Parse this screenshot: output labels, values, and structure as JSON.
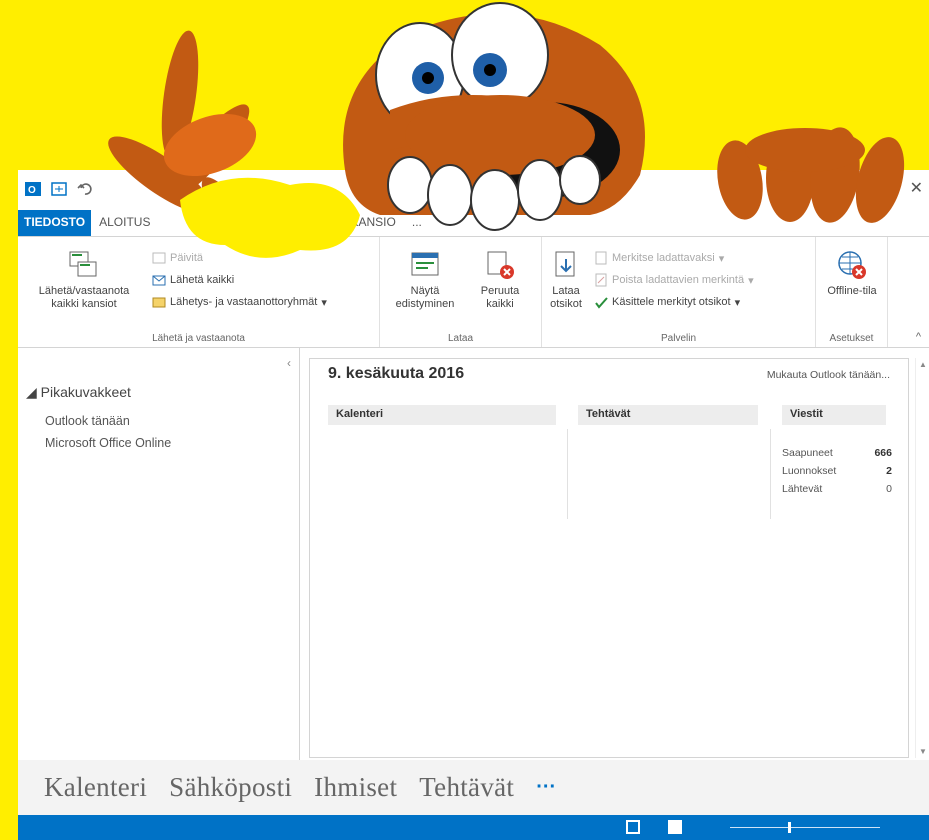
{
  "colors": {
    "background": "#ffee00",
    "accent": "#0072c6",
    "monster": "#c25a13",
    "monster_light": "#e06a1a"
  },
  "window": {
    "close_glyph": "✕"
  },
  "tabs": [
    {
      "label": "TIEDOSTO"
    },
    {
      "label": "ALOITUS"
    },
    {
      "label": "A"
    },
    {
      "label": "KANSIO"
    },
    {
      "label": "..."
    }
  ],
  "ribbon": {
    "send_receive": {
      "send_receive_all": "Lähetä/vastaanota kaikki kansiot",
      "update_folder": "Päivitä",
      "send_all": "Lähetä kaikki",
      "groups": "Lähetys- ja vastaanottoryhmät",
      "group_label": "Lähetä ja vastaanota"
    },
    "download": {
      "show_progress": "Näytä edistyminen",
      "cancel_all": "Peruuta kaikki",
      "group_label": "Lataa"
    },
    "server": {
      "download_headers": "Lataa otsikot",
      "mark_to_download": "Merkitse ladattavaksi",
      "unmark": "Poista ladattavien merkintä",
      "process_marked": "Käsittele merkityt otsikot",
      "group_label": "Palvelin"
    },
    "preferences": {
      "offline": "Offline-tila",
      "group_label": "Asetukset"
    },
    "collapse_glyph": "^"
  },
  "navpane": {
    "collapse_glyph": "‹",
    "heading": "◢ Pikakuvakkeet",
    "items": [
      {
        "label": "Outlook tänään"
      },
      {
        "label": "Microsoft Office Online"
      }
    ]
  },
  "today": {
    "date": "9. kesäkuuta 2016",
    "customize": "Mukauta Outlook tänään...",
    "columns": {
      "calendar": "Kalenteri",
      "tasks": "Tehtävät",
      "messages": "Viestit"
    },
    "messages": [
      {
        "label": "Saapuneet",
        "count": "666"
      },
      {
        "label": "Luonnokset",
        "count": "2"
      },
      {
        "label": "Lähtevät",
        "count": "0"
      }
    ]
  },
  "bottomnav": {
    "items": [
      {
        "label": "Kalenteri"
      },
      {
        "label": "Sähköposti"
      },
      {
        "label": "Ihmiset"
      },
      {
        "label": "Tehtävät"
      }
    ],
    "more": "···"
  }
}
